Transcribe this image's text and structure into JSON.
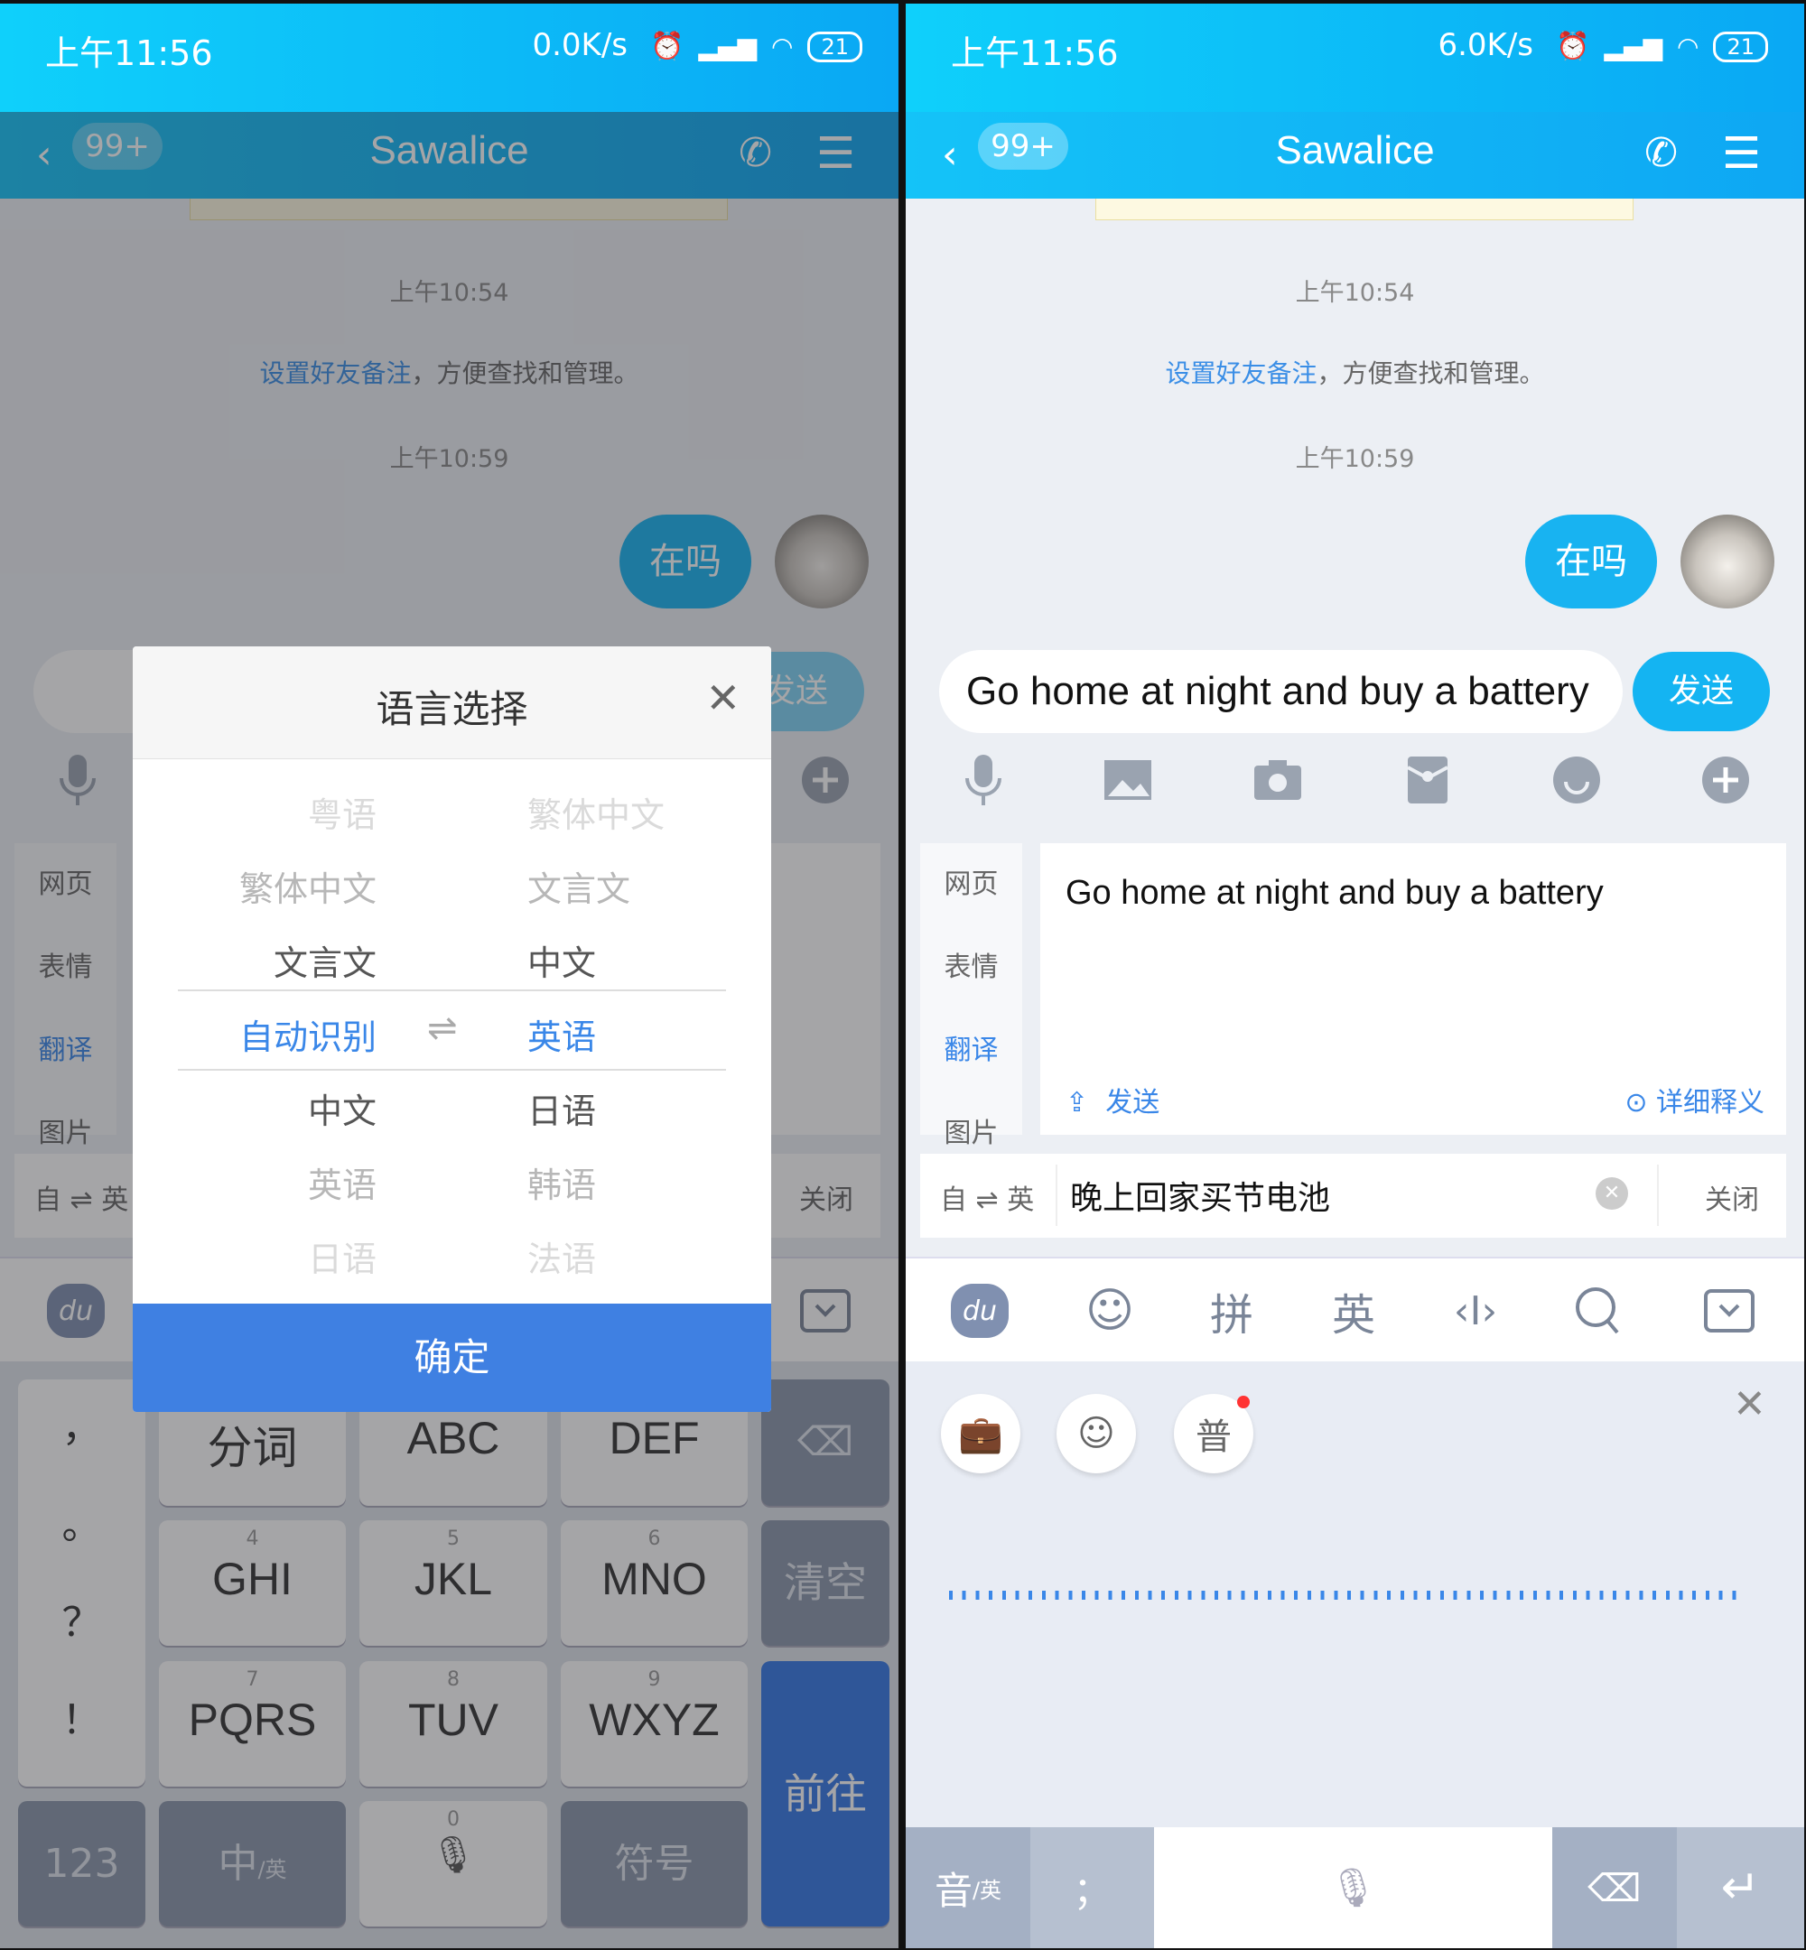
{
  "left": {
    "status": {
      "time": "上午11:56",
      "speed": "0.0K/s",
      "battery": "21"
    },
    "nav": {
      "badge": "99+",
      "title": "Sawalice"
    },
    "chat": {
      "time1": "上午10:54",
      "notice_link": "设置好友备注",
      "notice_rest": "，方便查找和管理。",
      "time2": "上午10:59",
      "bubble": "在吗"
    },
    "send_label": "发送",
    "side_tabs": [
      "网页",
      "表情",
      "翻译",
      "图片"
    ],
    "translate_bar": {
      "from": "自",
      "to": "英",
      "close": "关闭"
    },
    "dialog": {
      "title": "语言选择",
      "left_options": [
        "粤语",
        "繁体中文",
        "文言文",
        "自动识别",
        "中文",
        "英语",
        "日语"
      ],
      "right_options": [
        "繁体中文",
        "文言文",
        "中文",
        "英语",
        "日语",
        "韩语",
        "法语"
      ],
      "selected_left": "自动识别",
      "selected_right": "英语",
      "confirm": "确定"
    },
    "keyboard": {
      "symbols": [
        "，",
        "。",
        "？",
        "！"
      ],
      "keys": [
        {
          "num": "",
          "label": "分词"
        },
        {
          "num": "",
          "label": "ABC"
        },
        {
          "num": "",
          "label": "DEF"
        },
        {
          "num": "4",
          "label": "GHI"
        },
        {
          "num": "5",
          "label": "JKL"
        },
        {
          "num": "6",
          "label": "MNO"
        },
        {
          "num": "7",
          "label": "PQRS"
        },
        {
          "num": "8",
          "label": "TUV"
        },
        {
          "num": "9",
          "label": "WXYZ"
        }
      ],
      "clear": "清空",
      "go": "前往",
      "num_mode": "123",
      "lang_main": "中",
      "lang_sub": "/英",
      "zero": "0",
      "symbol": "符号"
    }
  },
  "right": {
    "status": {
      "time": "上午11:56",
      "speed": "6.0K/s",
      "battery": "21"
    },
    "nav": {
      "badge": "99+",
      "title": "Sawalice"
    },
    "chat": {
      "time1": "上午10:54",
      "notice_link": "设置好友备注",
      "notice_rest": "，方便查找和管理。",
      "time2": "上午10:59",
      "bubble": "在吗"
    },
    "input_value": "Go home at night and buy a battery",
    "send_label": "发送",
    "side_tabs": [
      "网页",
      "表情",
      "翻译",
      "图片"
    ],
    "translation": {
      "result": "Go home at night and buy a battery",
      "send": "发送",
      "details": "详细释义"
    },
    "translate_bar": {
      "from": "自",
      "to": "英",
      "source_text": "晚上回家买节电池",
      "close": "关闭"
    },
    "toolbar": {
      "pinyin": "拼",
      "english": "英"
    },
    "voice_panel": {
      "mandarin": "普"
    },
    "bottom_bar": {
      "lang_main": "音",
      "lang_sub": "/英",
      "semicolon": "；"
    }
  },
  "colors": {
    "accent": "#12b7f5",
    "link": "#3a8ee6",
    "confirm": "#3f80e2",
    "selected": "#3a87e8"
  }
}
